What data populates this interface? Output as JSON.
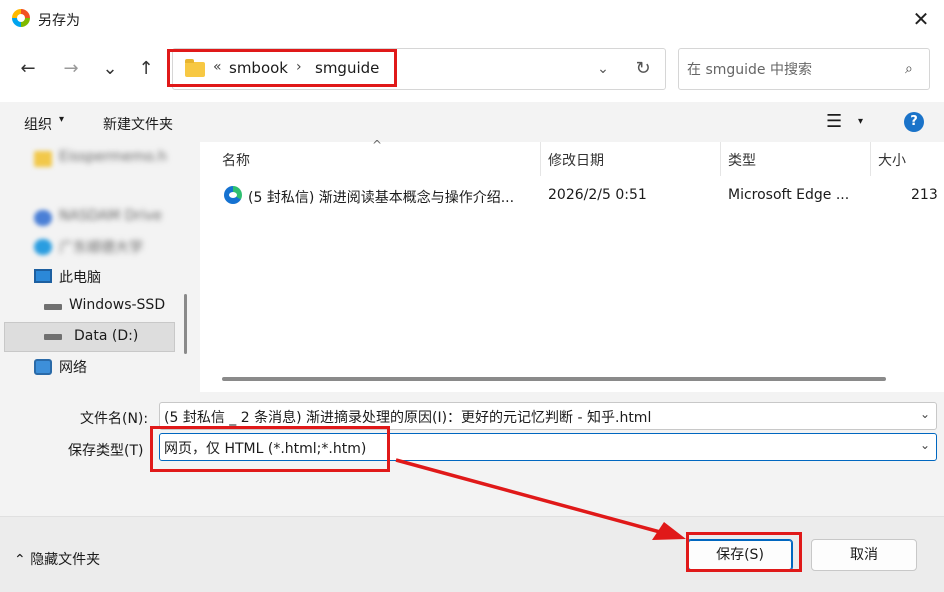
{
  "window": {
    "title": "另存为",
    "close_glyph": "✕"
  },
  "nav": {
    "back": "←",
    "forward": "→",
    "recent": "⌄",
    "up": "↑",
    "address": {
      "sep0": "«",
      "crumb1": "smbook",
      "sep1": "›",
      "crumb2": "smguide",
      "dropdown": "⌄",
      "refresh": "↻"
    },
    "search": {
      "placeholder": "在 smguide 中搜索",
      "icon": "⌕"
    }
  },
  "toolbar": {
    "organize": "组织",
    "organize_caret": "▾",
    "new_folder": "新建文件夹",
    "view_glyph": "☰",
    "view_caret": "▾",
    "help": "?"
  },
  "sidebar": {
    "items": [
      {
        "label": "Eisspermemo.h",
        "blurred": true
      },
      {
        "label": "NASDAM Drive",
        "blurred": true
      },
      {
        "label": "广东顺德大学",
        "blurred": true
      },
      {
        "label": "此电脑",
        "blurred": false
      },
      {
        "label": "Windows-SSD",
        "blurred": false
      },
      {
        "label": "Data (D:)",
        "blurred": false,
        "selected": true
      },
      {
        "label": "网络",
        "blurred": false
      }
    ]
  },
  "file_list": {
    "columns": [
      "名称",
      "修改日期",
      "类型",
      "大小"
    ],
    "sort_glyph": "^",
    "rows": [
      {
        "name": "(5 封私信) 渐进阅读基本概念与操作介绍...",
        "date": "2026/2/5 0:51",
        "type": "Microsoft Edge ...",
        "size": "213"
      }
    ]
  },
  "form": {
    "filename_label": "文件名(N):",
    "filename_value": "(5 封私信 _ 2 条消息) 渐进摘录处理的原因(I)：更好的元记忆判断 - 知乎.html",
    "filetype_label": "保存类型(T)",
    "filetype_value": "网页，仅 HTML (*.html;*.htm)",
    "caret": "⌄"
  },
  "footer": {
    "hide_folders": "隐藏文件夹",
    "hide_caret": "⌃",
    "save": "保存(S)",
    "cancel": "取消"
  },
  "annotation_color": "#e01919"
}
